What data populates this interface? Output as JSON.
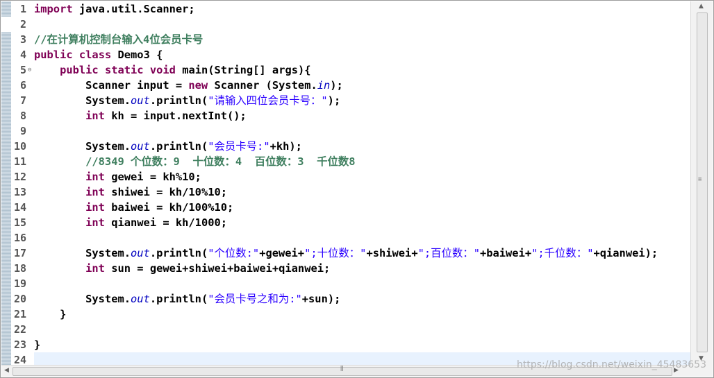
{
  "editor": {
    "line_numbers": [
      "1",
      "2",
      "3",
      "4",
      "5",
      "6",
      "7",
      "8",
      "9",
      "10",
      "11",
      "12",
      "13",
      "14",
      "15",
      "16",
      "17",
      "18",
      "19",
      "20",
      "21",
      "22",
      "23",
      "24"
    ],
    "fold_marker": "⊖",
    "code": {
      "l1_kw": "import",
      "l1_rest": " java.util.Scanner;",
      "l3_comment": "//在计算机控制台输入4位会员卡号",
      "l4_kw1": "public",
      "l4_kw2": "class",
      "l4_rest": " Demo3 {",
      "l5_indent": "    ",
      "l5_kw1": "public",
      "l5_kw2": "static",
      "l5_kw3": "void",
      "l5_rest": " main(String[] args){",
      "l6_a": "        Scanner input = ",
      "l6_kw": "new",
      "l6_b": " Scanner (System.",
      "l6_field": "in",
      "l6_c": ");",
      "l7_a": "        System.",
      "l7_field": "out",
      "l7_b": ".println(",
      "l7_str": "\"请输入四位会员卡号：\"",
      "l7_c": ");",
      "l8_kw": "int",
      "l8_rest": " kh = input.nextInt();",
      "l10_a": "        System.",
      "l10_field": "out",
      "l10_b": ".println(",
      "l10_str": "\"会员卡号:\"",
      "l10_c": "+kh);",
      "l11_comment": "        //8349 个位数：9  十位数：4  百位数：3  千位数8",
      "l12_kw": "int",
      "l12_rest": " gewei = kh%10;",
      "l13_kw": "int",
      "l13_rest": " shiwei = kh/10%10;",
      "l14_kw": "int",
      "l14_rest": " baiwei = kh/100%10;",
      "l15_kw": "int",
      "l15_rest": " qianwei = kh/1000;",
      "l17_a": "        System.",
      "l17_field": "out",
      "l17_b": ".println(",
      "l17_s1": "\"个位数:\"",
      "l17_c": "+gewei+",
      "l17_s2": "\";十位数：\"",
      "l17_d": "+shiwei+",
      "l17_s3": "\";百位数：\"",
      "l17_e": "+baiwei+",
      "l17_s4": "\";千位数：\"",
      "l17_f": "+qianwei);",
      "l18_kw": "int",
      "l18_rest": " sun = gewei+shiwei+baiwei+qianwei;",
      "l20_a": "        System.",
      "l20_field": "out",
      "l20_b": ".println(",
      "l20_str": "\"会员卡号之和为:\"",
      "l20_c": "+sun);",
      "l21": "    }",
      "l23": "}"
    }
  },
  "watermark": "https://blog.csdn.net/weixin_45483653",
  "colors": {
    "keyword": "#7f0055",
    "string": "#2a00ff",
    "comment": "#3f7f5f",
    "field": "#0000c0",
    "current_line": "#e8f2fe"
  }
}
